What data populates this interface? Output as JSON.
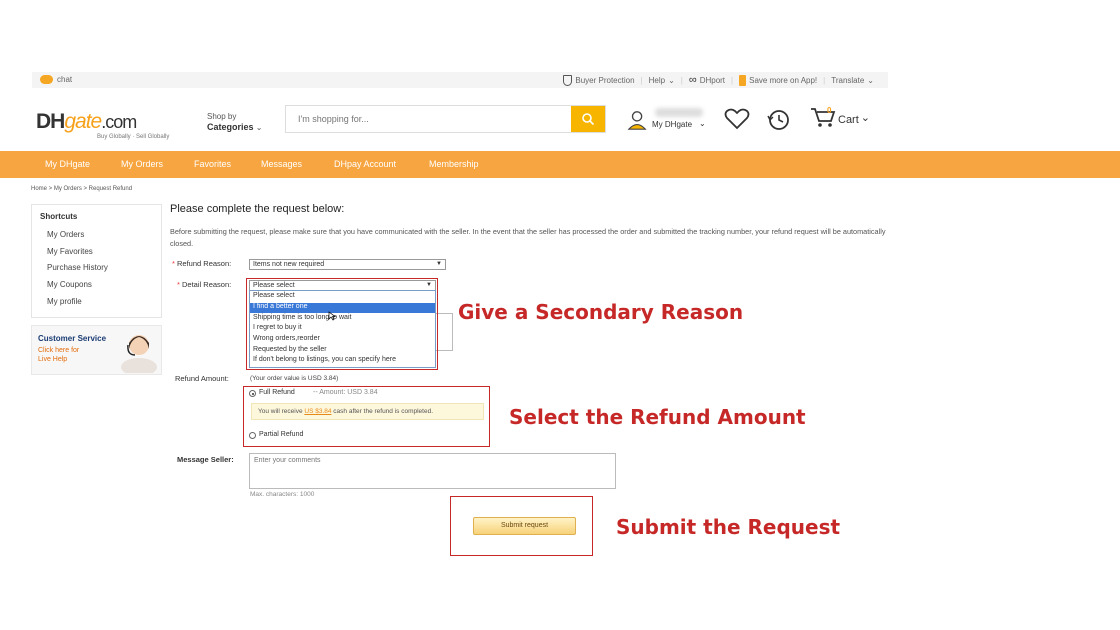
{
  "topbar": {
    "chat": "chat",
    "buyer_protection": "Buyer Protection",
    "help": "Help",
    "dhport": "DHport",
    "save_app": "Save more on App!",
    "translate": "Translate"
  },
  "header": {
    "logo_dh": "DH",
    "logo_g": "gate",
    "logo_com": ".com",
    "tagline": "Buy Globally · Sell Globally",
    "shop_by": "Shop by",
    "categories": "Categories",
    "search_placeholder": "I'm shopping for...",
    "my_dhgate": "My DHgate",
    "cart": "Cart",
    "cart_count": "0"
  },
  "nav": {
    "items": [
      "My DHgate",
      "My Orders",
      "Favorites",
      "Messages",
      "DHpay Account",
      "Membership"
    ]
  },
  "breadcrumb": "Home > My Orders > Request Refund",
  "sidebar": {
    "title": "Shortcuts",
    "items": [
      "My Orders",
      "My Favorites",
      "Purchase History",
      "My Coupons",
      "My profile"
    ],
    "cs_title": "Customer Service",
    "cs_sub1": "Click here for",
    "cs_sub2": "Live Help"
  },
  "form": {
    "title": "Please complete the request below:",
    "intro": "Before submitting the request, please make sure that you have communicated with the seller. In the event that the seller has processed the order and submitted the tracking number, your refund request will be automatically closed.",
    "refund_reason_label": "Refund Reason:",
    "refund_reason_value": "Items not new required",
    "detail_reason_label": "Detail Reason:",
    "detail_reason_value": "Please select",
    "detail_options": [
      "Please select",
      "I find a better one",
      "Shipping time is too long to wait",
      "I regret to buy it",
      "Wrong orders,reorder",
      "Requested by the seller",
      "If don't belong to listings, you can specify here"
    ],
    "refund_amount_label": "Refund Amount:",
    "order_value_note": "(Your order value is USD 3.84)",
    "full_refund": "Full Refund",
    "amount_text": "-- Amount: USD 3.84",
    "notice_pre": "You will receive",
    "notice_amount": "US $3.84",
    "notice_post": "cash after the refund is completed.",
    "partial_refund": "Partial Refund",
    "message_label": "Message Seller:",
    "message_placeholder": "Enter your comments",
    "max_chars": "Max. characters: 1000",
    "submit": "Submit request"
  },
  "annotations": {
    "secondary_reason": "Give a Secondary Reason",
    "refund_amount": "Select the Refund Amount",
    "submit_request": "Submit the Request"
  },
  "colors": {
    "nav_orange": "#f7a540",
    "search_yellow": "#f7b500",
    "annotation_red": "#c62828",
    "highlight_blue": "#3a78d8"
  }
}
